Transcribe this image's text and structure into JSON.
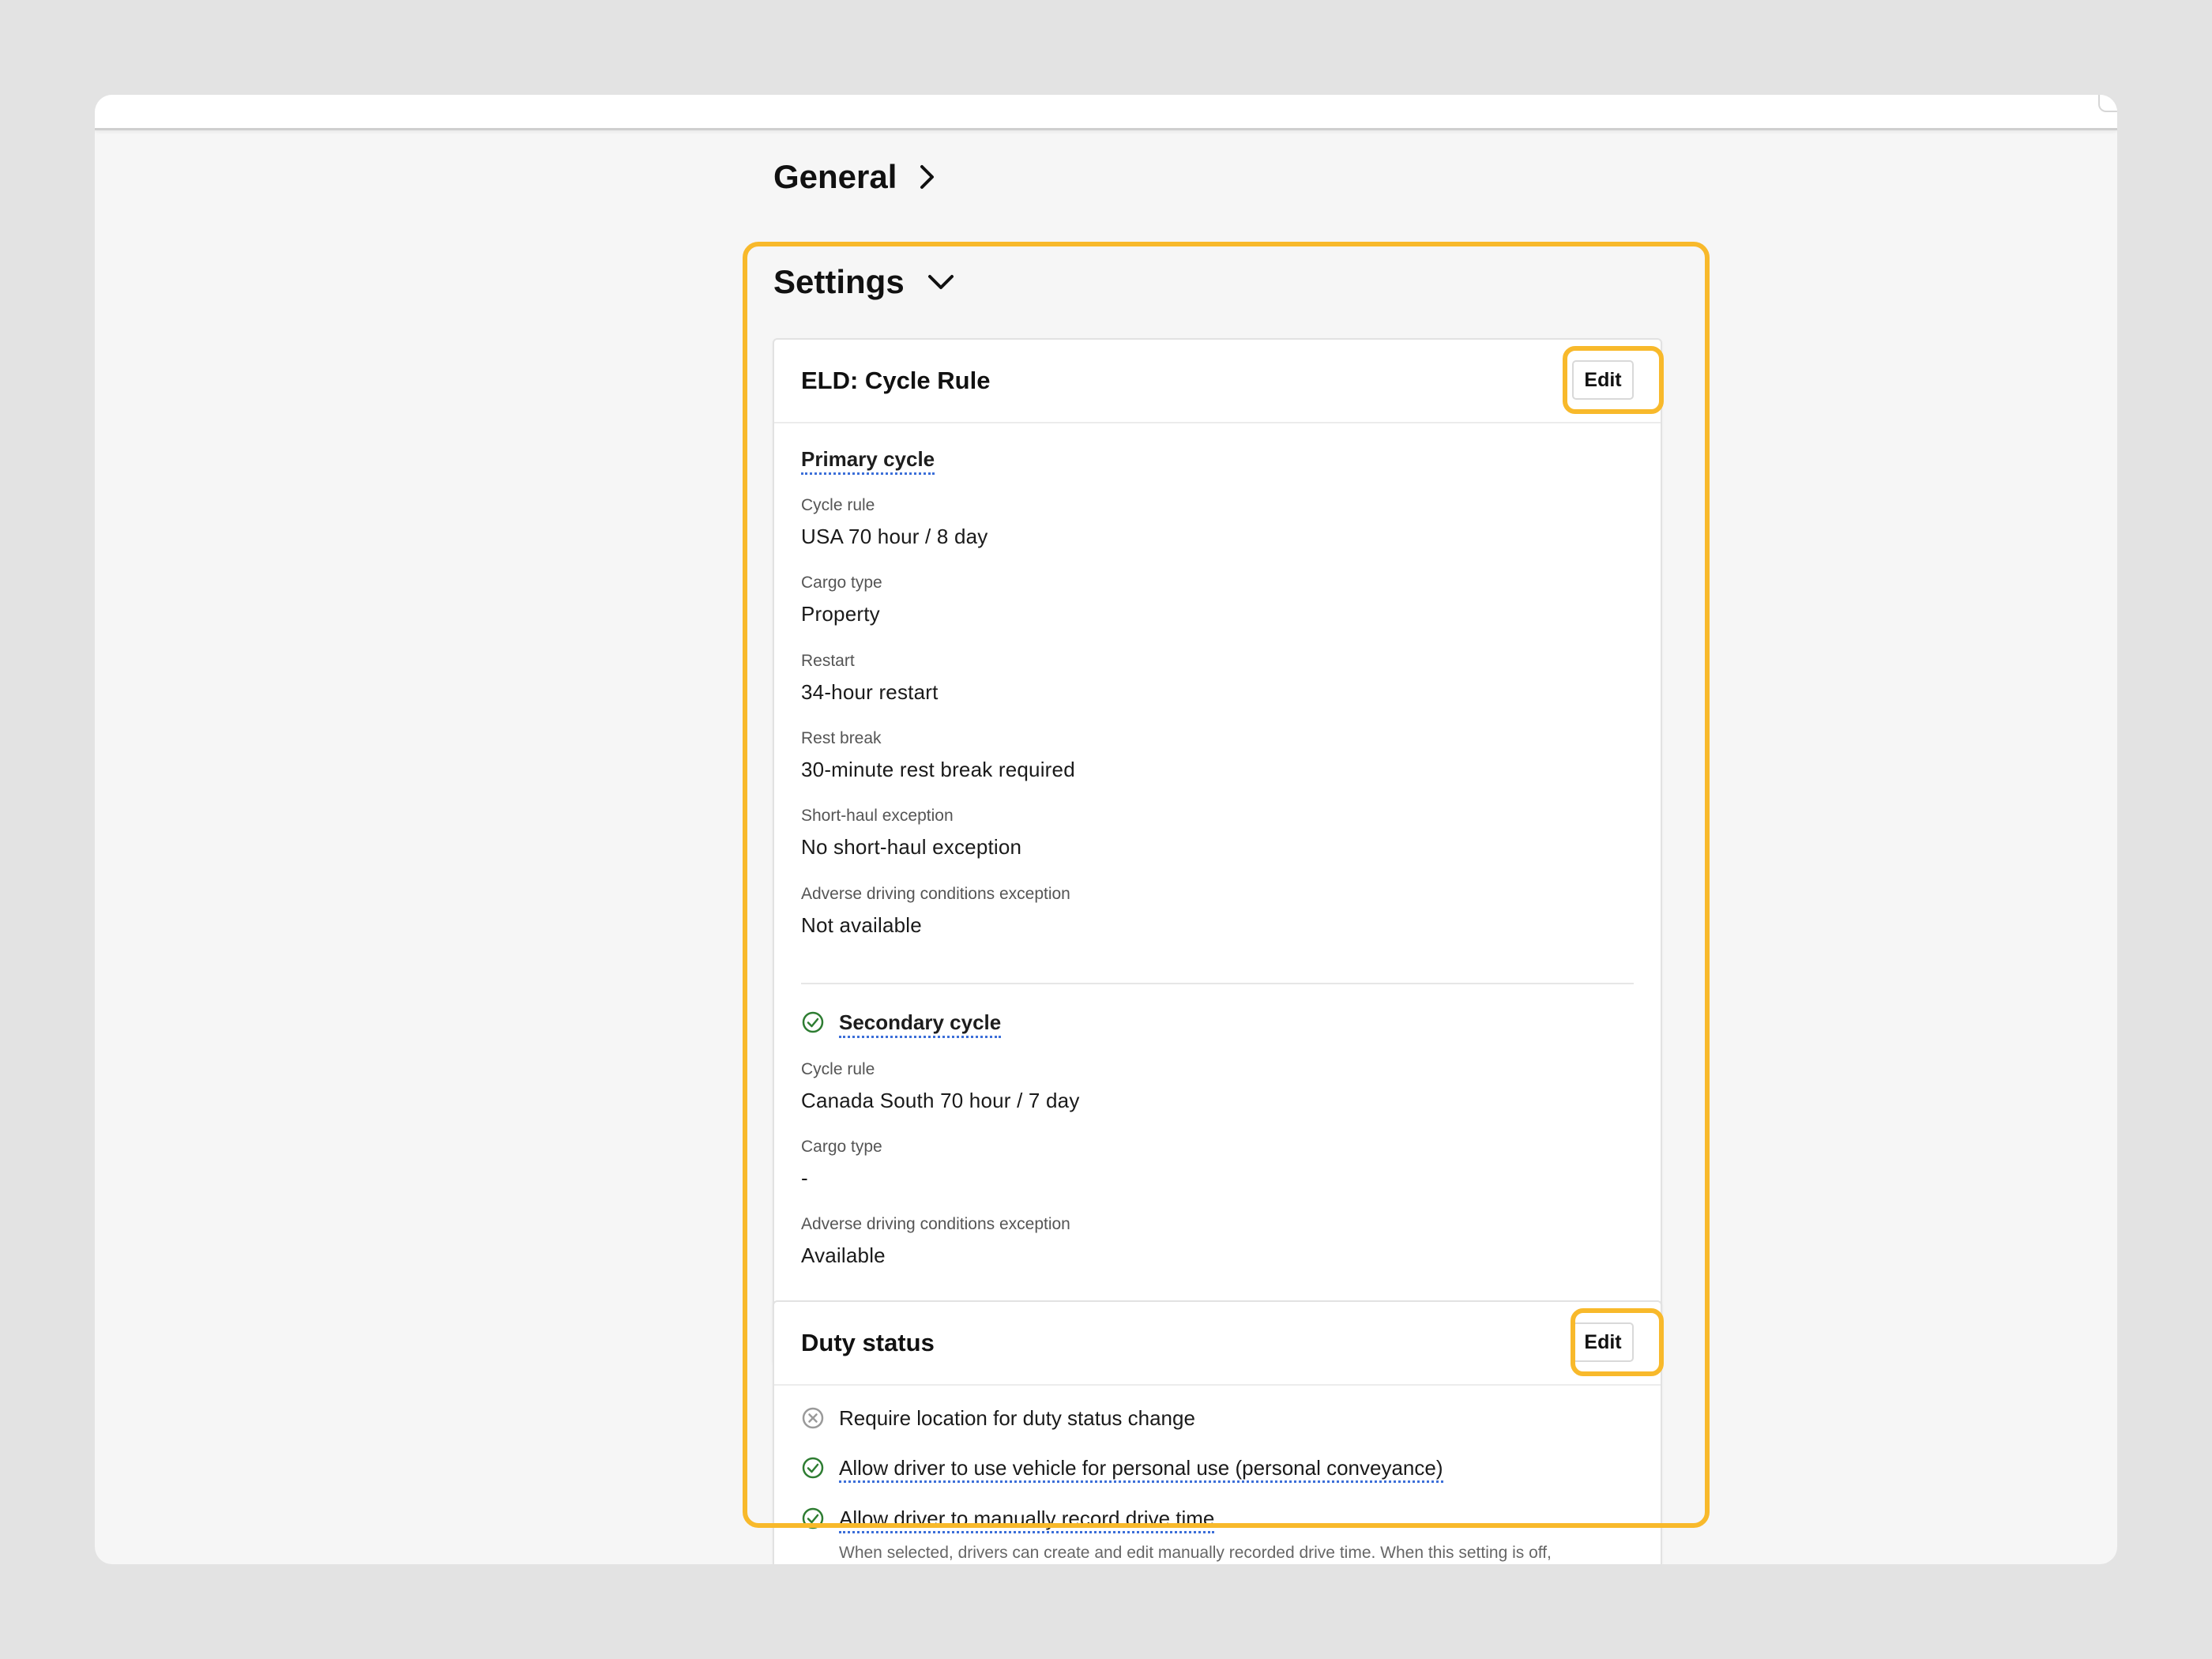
{
  "sections": {
    "general": {
      "title": "General"
    },
    "settings": {
      "title": "Settings"
    }
  },
  "cycle_card": {
    "title": "ELD: Cycle Rule",
    "edit_label": "Edit",
    "primary": {
      "heading": "Primary cycle",
      "fields": [
        {
          "label": "Cycle rule",
          "value": "USA 70 hour / 8 day"
        },
        {
          "label": "Cargo type",
          "value": "Property"
        },
        {
          "label": "Restart",
          "value": "34-hour restart"
        },
        {
          "label": "Rest break",
          "value": "30-minute rest break required"
        },
        {
          "label": "Short-haul exception",
          "value": "No short-haul exception"
        },
        {
          "label": "Adverse driving conditions exception",
          "value": "Not available"
        }
      ]
    },
    "secondary": {
      "heading": "Secondary cycle",
      "enabled": true,
      "fields": [
        {
          "label": "Cycle rule",
          "value": "Canada South 70 hour / 7 day"
        },
        {
          "label": "Cargo type",
          "value": "-"
        },
        {
          "label": "Adverse driving conditions exception",
          "value": "Available"
        }
      ]
    }
  },
  "duty_card": {
    "title": "Duty status",
    "edit_label": "Edit",
    "items": [
      {
        "label": "Require location for duty status change",
        "enabled": false
      },
      {
        "label": "Allow driver to use vehicle for personal use (personal conveyance)",
        "enabled": true
      },
      {
        "label": "Allow driver to manually record drive time",
        "enabled": true
      }
    ],
    "helper": "When selected, drivers can create and edit manually recorded drive time. When this setting is off,"
  },
  "colors": {
    "highlight": "#f8b92b",
    "enabled": "#2e7d32",
    "disabled": "#9a9a9a",
    "dotted_underline": "#3b6ed8"
  }
}
